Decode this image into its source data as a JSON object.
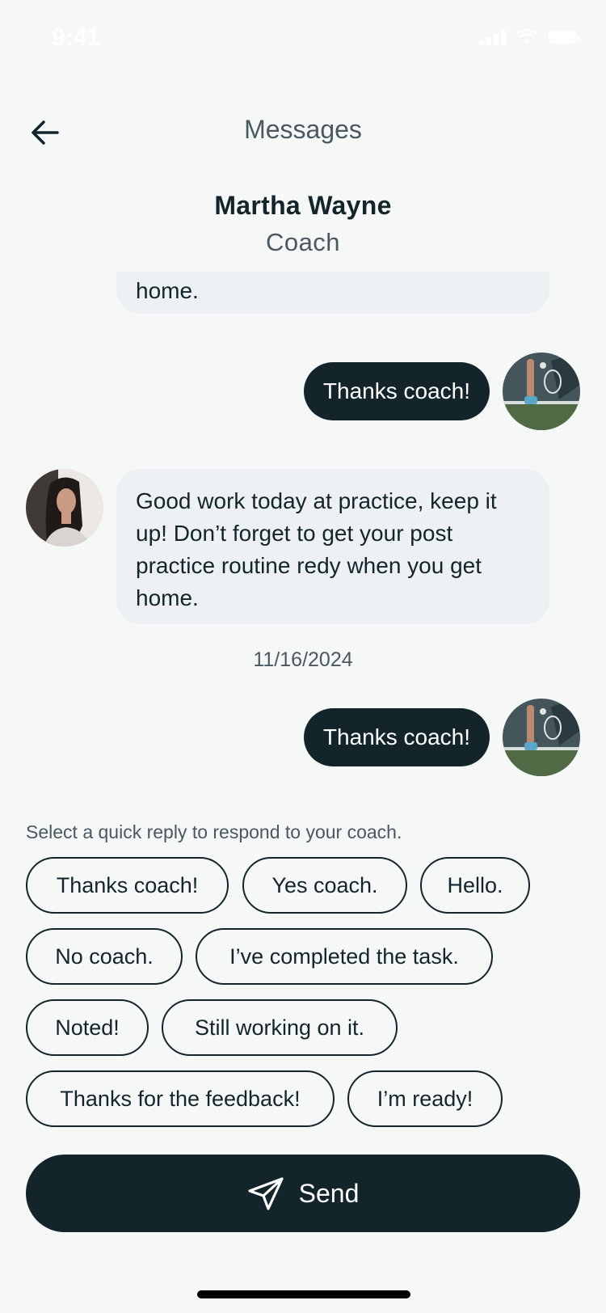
{
  "status_bar": {
    "time": "9:41"
  },
  "header": {
    "title": "Messages",
    "back_icon": "arrow-left-icon"
  },
  "contact": {
    "name": "Martha Wayne",
    "role": "Coach"
  },
  "messages": [
    {
      "from": "coach",
      "text": "home."
    },
    {
      "from": "me",
      "text": "Thanks coach!"
    },
    {
      "from": "coach",
      "text": "Good work today at practice, keep it up! Don’t forget to get your post practice routine redy when you get home."
    },
    {
      "from": "me",
      "text": "Thanks coach!"
    }
  ],
  "date_separator": "11/16/2024",
  "quick_reply": {
    "hint": "Select a quick reply to respond to your coach.",
    "options": [
      "Thanks coach!",
      "Yes coach.",
      "Hello.",
      "No coach.",
      "I’ve completed the task.",
      "Noted!",
      "Still working on it.",
      "Thanks for the feedback!",
      "I’m ready!"
    ]
  },
  "send": {
    "label": "Send",
    "icon": "send-icon"
  },
  "colors": {
    "primary": "#13252b",
    "bubble_in": "#edf1f3",
    "background": "#f6f8f8",
    "muted": "#4a5860"
  }
}
